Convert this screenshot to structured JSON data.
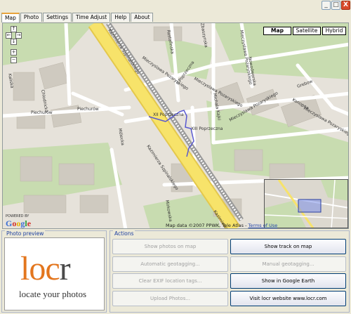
{
  "window": {
    "min_label": "_",
    "max_label": "□",
    "close_label": "X"
  },
  "tabs": [
    "Map",
    "Photo",
    "Settings",
    "Time Adjust",
    "Help",
    "About"
  ],
  "map": {
    "type_buttons": [
      "Map",
      "Satellite",
      "Hybrid"
    ],
    "selected_type": "Map",
    "nav": {
      "up": "↑",
      "down": "↓",
      "left": "←",
      "right": "→",
      "zoom_in": "+",
      "zoom_out": "−"
    },
    "copyright": "Map data ©2007 PPWK, Tele Atlas - ",
    "terms_link": "Terms of Use",
    "powered_by": "POWERED BY",
    "google": "Google",
    "track_color": "#5a5ad0",
    "streets": {
      "kazimierza_top": "Kazimierza Szpinalskiego",
      "kazimierza_mid": "Kazimierza Szpinalskiego",
      "kazimierza_bottom": "Kazimierza",
      "rostafinska": "Rostafinska",
      "mieczyslawa_1": "Mieczyslawa Pozaryskiego",
      "mieczyslawa_2": "Mieczyslawa Pozaryskiego",
      "mieczyslawa_3": "Mieczyslawa Pozaryskiego",
      "mieczyslawa_4": "Mieczyslawa Pozaryskiego",
      "mieczyslawa_5": "Mieczyslawa Pozaryskiego",
      "ii_poprzeczna": "II Poprzeczna",
      "xii_poprzeczna": "XII Poprzeczna",
      "xiii_poprzeczna": "XIII Poprzeczna",
      "michala_kajki": "Michala Kajki",
      "zbaszynska": "Zbaszynska",
      "nowodworska": "Nowodworska",
      "grebow": "Grebow",
      "konopna": "Konopna",
      "kaliska": "Kaliska",
      "chodkiewicza": "Chlodnicka",
      "piechurow_1": "Piechurów",
      "piechurow_2": "Piechurów",
      "molucka": "Mólecka",
      "mirkowska": "Mirkowska"
    }
  },
  "photo_preview": {
    "label": "Photo preview",
    "logo": {
      "l": "loc",
      "r": "r"
    },
    "tagline": "locate your photos"
  },
  "actions": {
    "label": "Actions",
    "buttons": [
      {
        "label": "Show photos on map",
        "enabled": false
      },
      {
        "label": "Show track on map",
        "enabled": true
      },
      {
        "label": "Automatic geotagging...",
        "enabled": false
      },
      {
        "label": "Manual geotagging...",
        "enabled": false
      },
      {
        "label": "Clear EXIF location tags...",
        "enabled": false
      },
      {
        "label": "Show in Google Earth",
        "enabled": true
      },
      {
        "label": "Upload Photos...",
        "enabled": false
      },
      {
        "label": "Visit locr website www.locr.com",
        "enabled": true
      }
    ]
  },
  "colors": {
    "accent_tab": "#e8a33c",
    "logo_orange": "#e3761e",
    "road_yellow": "#f7e36a",
    "park_green": "#c8dcb0"
  }
}
